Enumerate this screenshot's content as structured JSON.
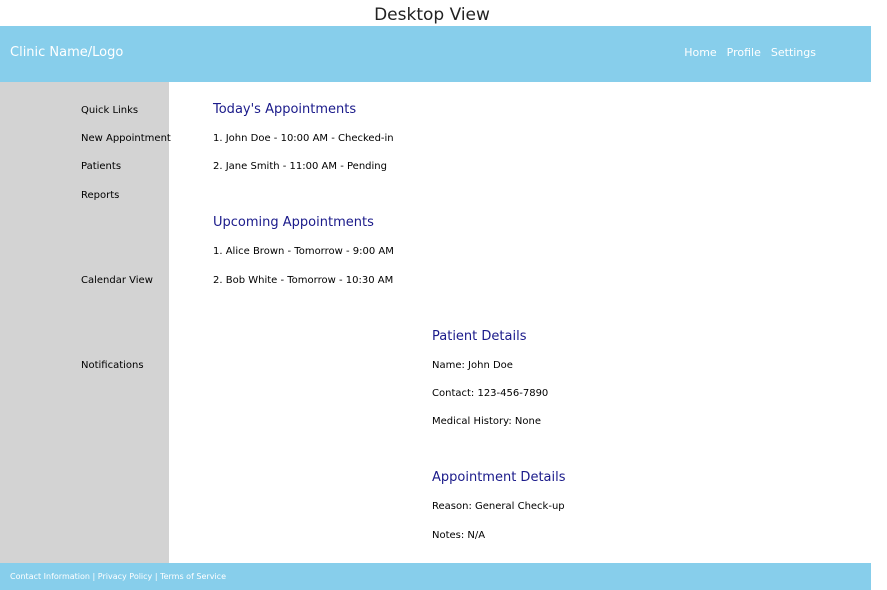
{
  "page_title": "Desktop View",
  "header": {
    "brand": "Clinic Name/Logo",
    "nav": [
      "Home",
      "Profile",
      "Settings"
    ]
  },
  "sidebar": {
    "items": [
      "Quick Links",
      "New Appointment",
      "Patients",
      "Reports",
      "Calendar View",
      "Notifications"
    ]
  },
  "todays": {
    "title": "Today's Appointments",
    "items": [
      "1. John Doe - 10:00 AM - Checked-in",
      "2. Jane Smith - 11:00 AM - Pending"
    ]
  },
  "upcoming": {
    "title": "Upcoming Appointments",
    "items": [
      "1. Alice Brown - Tomorrow - 9:00 AM",
      "2. Bob White - Tomorrow - 10:30 AM"
    ]
  },
  "patient": {
    "title": "Patient Details",
    "name": "Name: John Doe",
    "contact": "Contact: 123-456-7890",
    "history": "Medical History: None"
  },
  "appointment": {
    "title": "Appointment Details",
    "reason": "Reason: General Check-up",
    "notes": "Notes: N/A"
  },
  "footer": {
    "contact": "Contact Information",
    "separator": " | ",
    "privacy": "Privacy Policy",
    "terms": "Terms of Service"
  },
  "colors": {
    "header_bg": "#87ceeb",
    "sidebar_bg": "#d3d3d3",
    "section_title": "#1a1a8a"
  }
}
